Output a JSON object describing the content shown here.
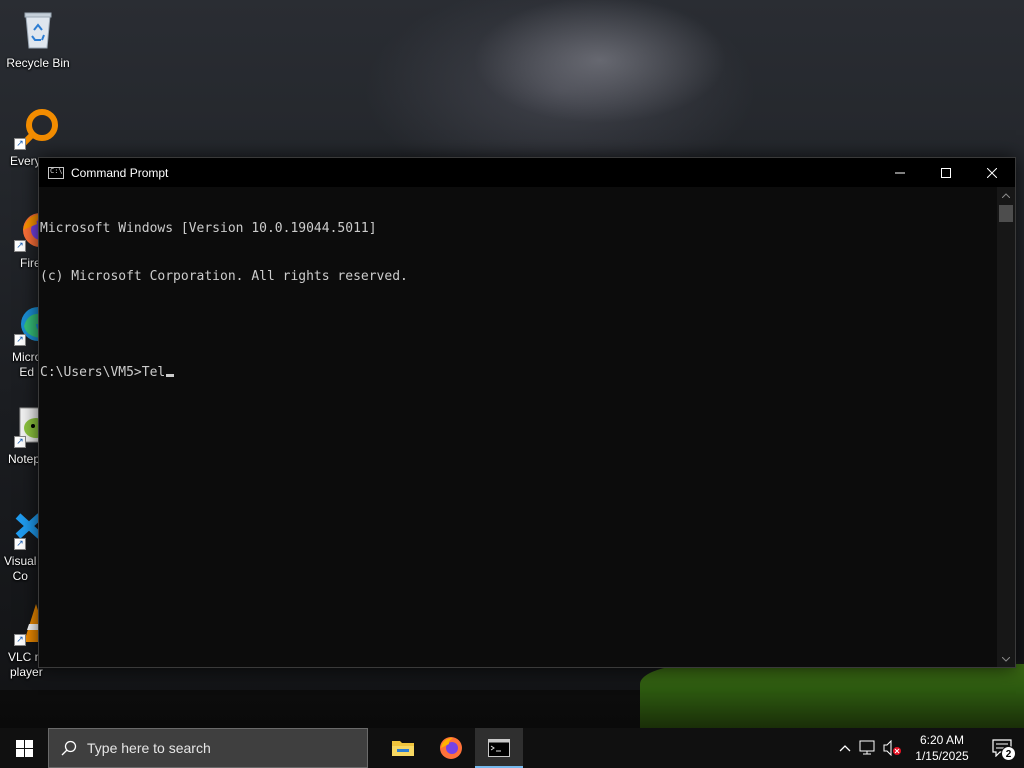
{
  "desktop": {
    "icons": [
      {
        "label": "Recycle Bin",
        "icon": "recycle-bin-icon"
      },
      {
        "label": "Every",
        "icon": "everything-search-icon"
      },
      {
        "label": "Fire",
        "icon": "firefox-icon"
      },
      {
        "label": "Micro\nEd",
        "icon": "edge-icon"
      },
      {
        "label": "Notep",
        "icon": "notepad-plus-plus-icon"
      },
      {
        "label": "Visual\nCo",
        "icon": "vscode-icon"
      },
      {
        "label": "VLC m\nplayer",
        "icon": "vlc-icon"
      }
    ]
  },
  "cmd": {
    "title": "Command Prompt",
    "icon": "cmd-icon",
    "lines": [
      "Microsoft Windows [Version 10.0.19044.5011]",
      "(c) Microsoft Corporation. All rights reserved.",
      "",
      "C:\\Users\\VM5>Tel"
    ],
    "controls": {
      "minimize": "minimize-icon",
      "maximize": "maximize-icon",
      "close": "close-icon"
    }
  },
  "taskbar": {
    "search_placeholder": "Type here to search",
    "apps": [
      {
        "name": "File Explorer",
        "icon": "folder-icon"
      },
      {
        "name": "Firefox",
        "icon": "firefox-icon"
      },
      {
        "name": "Command Prompt",
        "icon": "cmd-icon",
        "active": true
      }
    ],
    "tray": {
      "time": "6:20 AM",
      "date": "1/15/2025",
      "notification_count": "2"
    }
  },
  "colors": {
    "console_text": "#cccccc",
    "console_bg": "#0c0c0c",
    "taskbar_bg": "#101010",
    "active_indicator": "#76b9ed"
  }
}
